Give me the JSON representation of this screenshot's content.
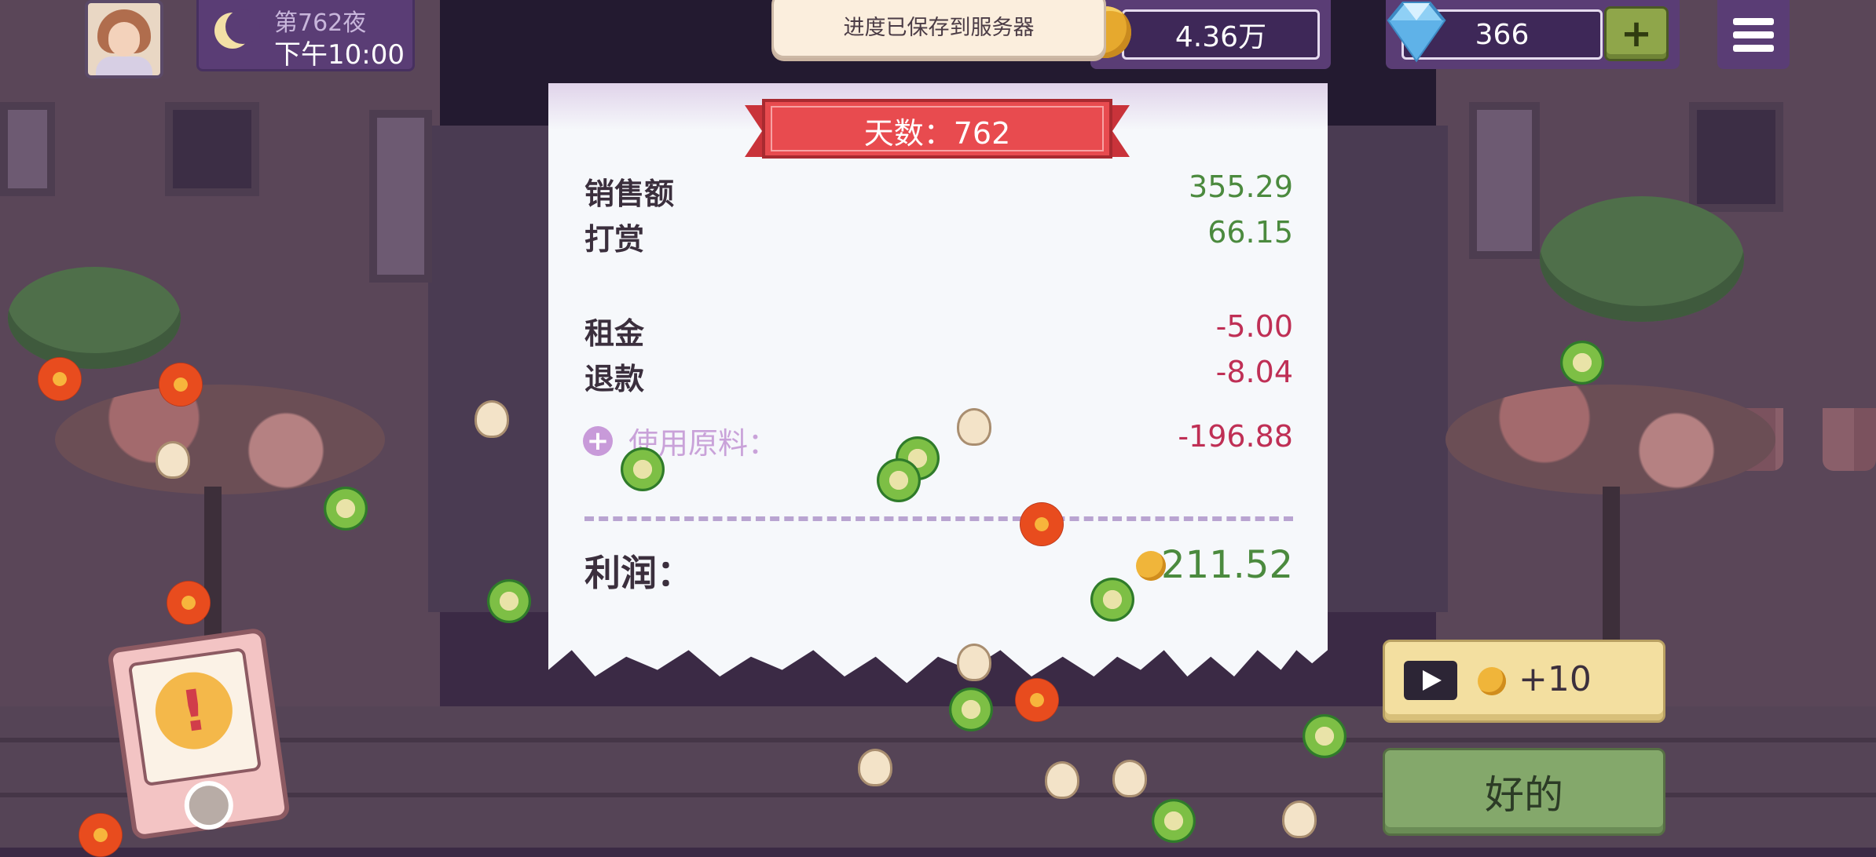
{
  "hud": {
    "night_label": "第762夜",
    "time_label": "下午10:00",
    "coins": "4.36万",
    "gems": "366",
    "plus_label": "+",
    "save_toast": "进度已保存到服务器"
  },
  "receipt": {
    "day_title": "天数：762",
    "rows": [
      {
        "label": "销售额",
        "value": "355.29"
      },
      {
        "label": "打赏",
        "value": "66.15"
      },
      {
        "label": "租金",
        "value": "-5.00"
      },
      {
        "label": "退款",
        "value": "-8.04"
      }
    ],
    "ingredients_label": "使用原料：",
    "ingredients_value": "-196.88",
    "ingredients_plus": "+",
    "profit_label": "利润：",
    "profit_value": "211.52"
  },
  "buttons": {
    "ad_reward": "+10",
    "ok": "好的"
  },
  "colors": {
    "positive": "#4b8a3e",
    "negative": "#bf2f55",
    "ribbon": "#e84b4f",
    "hud_panel": "#5a3d75"
  },
  "icons": [
    "avatar",
    "moon-icon",
    "coin-icon",
    "gem-icon",
    "menu-icon",
    "play-icon",
    "alert-icon"
  ]
}
